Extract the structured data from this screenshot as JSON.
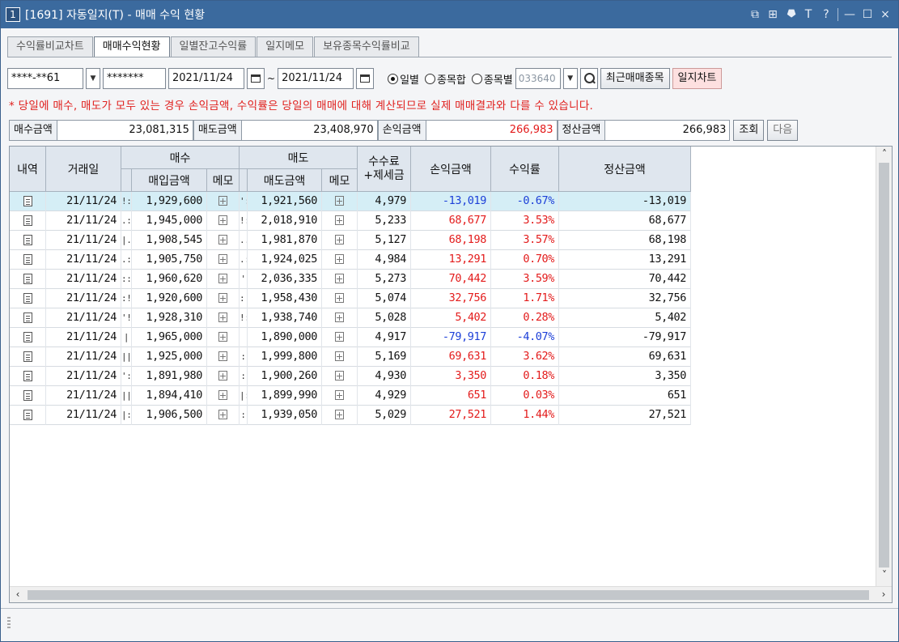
{
  "window": {
    "number": "1",
    "title": "[1691] 자동일지(T) - 매매 수익 현황",
    "controls": [
      "⧉",
      "⊞",
      "⯂",
      "T",
      "?",
      "—",
      "☐",
      "×"
    ]
  },
  "tabs": [
    {
      "label": "수익률비교차트",
      "active": false
    },
    {
      "label": "매매수익현황",
      "active": true
    },
    {
      "label": "일별잔고수익률",
      "active": false
    },
    {
      "label": "일지메모",
      "active": false
    },
    {
      "label": "보유종목수익률비교",
      "active": false
    }
  ],
  "toolbar": {
    "account": "****-**61",
    "password": "*******",
    "date_from": "2021/11/24",
    "tilde": "~",
    "date_to": "2021/11/24",
    "radio_daily": "일별",
    "radio_sum": "종목합",
    "radio_stock": "종목별",
    "stock_code": "033640",
    "recent_btn": "최근매매종목",
    "chart_btn": "일지차트"
  },
  "notice": "* 당일에 매수, 매도가 모두 있는 경우 손익금액, 수익률은 당일의 매매에 대해 계산되므로 실제 매매결과와 다를 수 있습니다.",
  "summary": {
    "buy_label": "매수금액",
    "buy_value": "23,081,315",
    "sell_label": "매도금액",
    "sell_value": "23,408,970",
    "pl_label": "손익금액",
    "pl_value": "266,983",
    "settle_label": "정산금액",
    "settle_value": "266,983",
    "query_btn": "조회",
    "next_btn": "다음"
  },
  "headers": {
    "detail": "내역",
    "date": "거래일",
    "buy": "매수",
    "buy_amt": "매입금액",
    "buy_memo": "메모",
    "sell": "매도",
    "sell_amt": "매도금액",
    "sell_memo": "메모",
    "fee1": "수수료",
    "fee2": "+제세금",
    "pl": "손익금액",
    "rate": "수익률",
    "settle": "정산금액"
  },
  "rows": [
    {
      "date": "21/11/24",
      "b": "!:",
      "buy": "1,929,600",
      "s": "':",
      "sell": "1,921,560",
      "fee": "4,979",
      "pl": "-13,019",
      "rate": "-0.67%",
      "settle": "-13,019",
      "neg": true
    },
    {
      "date": "21/11/24",
      "b": ".:",
      "buy": "1,945,000",
      "s": "!:",
      "sell": "2,018,910",
      "fee": "5,233",
      "pl": "68,677",
      "rate": "3.53%",
      "settle": "68,677",
      "neg": false
    },
    {
      "date": "21/11/24",
      "b": "|.",
      "buy": "1,908,545",
      "s": "..",
      "sell": "1,981,870",
      "fee": "5,127",
      "pl": "68,198",
      "rate": "3.57%",
      "settle": "68,198",
      "neg": false
    },
    {
      "date": "21/11/24",
      "b": ".:",
      "buy": "1,905,750",
      "s": ".:",
      "sell": "1,924,025",
      "fee": "4,984",
      "pl": "13,291",
      "rate": "0.70%",
      "settle": "13,291",
      "neg": false
    },
    {
      "date": "21/11/24",
      "b": "::",
      "buy": "1,960,620",
      "s": "'",
      "sell": "2,036,335",
      "fee": "5,273",
      "pl": "70,442",
      "rate": "3.59%",
      "settle": "70,442",
      "neg": false
    },
    {
      "date": "21/11/24",
      "b": ":!",
      "buy": "1,920,600",
      "s": ":!",
      "sell": "1,958,430",
      "fee": "5,074",
      "pl": "32,756",
      "rate": "1.71%",
      "settle": "32,756",
      "neg": false
    },
    {
      "date": "21/11/24",
      "b": "'!",
      "buy": "1,928,310",
      "s": "!:",
      "sell": "1,938,740",
      "fee": "5,028",
      "pl": "5,402",
      "rate": "0.28%",
      "settle": "5,402",
      "neg": false
    },
    {
      "date": "21/11/24",
      "b": "|",
      "buy": "1,965,000",
      "s": "",
      "sell": "1,890,000",
      "fee": "4,917",
      "pl": "-79,917",
      "rate": "-4.07%",
      "settle": "-79,917",
      "neg": true
    },
    {
      "date": "21/11/24",
      "b": "||",
      "buy": "1,925,000",
      "s": ":",
      "sell": "1,999,800",
      "fee": "5,169",
      "pl": "69,631",
      "rate": "3.62%",
      "settle": "69,631",
      "neg": false
    },
    {
      "date": "21/11/24",
      "b": "':",
      "buy": "1,891,980",
      "s": ":",
      "sell": "1,900,260",
      "fee": "4,930",
      "pl": "3,350",
      "rate": "0.18%",
      "settle": "3,350",
      "neg": false
    },
    {
      "date": "21/11/24",
      "b": "||",
      "buy": "1,894,410",
      "s": "|:",
      "sell": "1,899,990",
      "fee": "4,929",
      "pl": "651",
      "rate": "0.03%",
      "settle": "651",
      "neg": false
    },
    {
      "date": "21/11/24",
      "b": "|:",
      "buy": "1,906,500",
      "s": ":",
      "sell": "1,939,050",
      "fee": "5,029",
      "pl": "27,521",
      "rate": "1.44%",
      "settle": "27,521",
      "neg": false
    }
  ],
  "colors": {
    "negative": "#1c3fd8",
    "positive": "#e31b1b",
    "title_bar": "#3b6a9e",
    "selected_row": "#d5eef6"
  }
}
